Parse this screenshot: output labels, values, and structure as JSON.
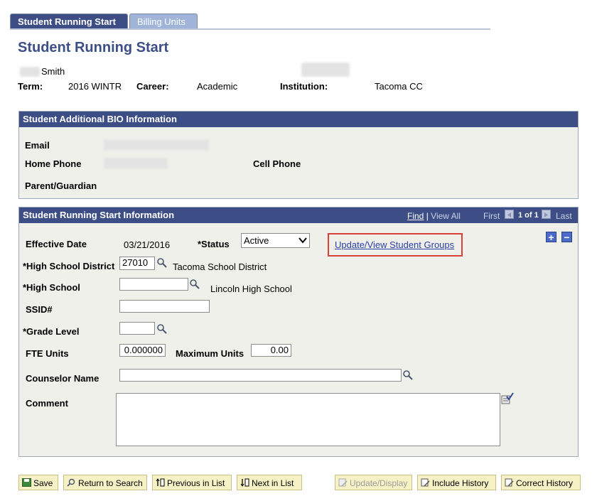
{
  "tabs": [
    {
      "label": "Student Running Start",
      "active": true
    },
    {
      "label": "Billing Units",
      "active": false
    }
  ],
  "page_title": "Student Running Start",
  "student": {
    "last_name": "Smith",
    "term_label": "Term:",
    "term_value": "2016 WINTR",
    "career_label": "Career:",
    "career_value": "Academic",
    "institution_label": "Institution:",
    "institution_value": "Tacoma CC"
  },
  "bio": {
    "header": "Student Additional BIO Information",
    "email_label": "Email",
    "home_phone_label": "Home Phone",
    "cell_phone_label": "Cell Phone",
    "parent_label": "Parent/Guardian"
  },
  "rs": {
    "header": "Student Running Start Information",
    "find": "Find",
    "separator": "|",
    "view_all": "View All",
    "first": "First",
    "count": "1 of 1",
    "last": "Last",
    "add_symbol": "+",
    "delete_symbol": "−",
    "effective_date_label": "Effective Date",
    "effective_date_value": "03/21/2016",
    "status_label": "*Status",
    "status_value": "Active",
    "update_groups_link": "Update/View Student Groups",
    "hs_district_label": "*High School District",
    "hs_district_value": "27010",
    "hs_district_desc": "Tacoma School District",
    "high_school_label": "*High School",
    "high_school_value": "",
    "high_school_desc": "Lincoln High School",
    "ssid_label": "SSID#",
    "ssid_value": "",
    "grade_level_label": "*Grade Level",
    "grade_level_value": "",
    "fte_label": "FTE Units",
    "fte_value": "0.000000",
    "max_units_label": "Maximum Units",
    "max_units_value": "0.00",
    "counselor_label": "Counselor Name",
    "counselor_value": "",
    "comment_label": "Comment",
    "comment_value": ""
  },
  "toolbar": {
    "save": "Save",
    "return_to_search": "Return to Search",
    "previous_in_list": "Previous in List",
    "next_in_list": "Next in List",
    "update_display": "Update/Display",
    "include_history": "Include History",
    "correct_history": "Correct History"
  },
  "colors": {
    "header_bg": "#3d4e86",
    "tab_inactive": "#9fb4d8",
    "group_bg": "#f0f0ea",
    "highlight_box": "#d9403a",
    "button_bg": "#f7f2c5"
  }
}
